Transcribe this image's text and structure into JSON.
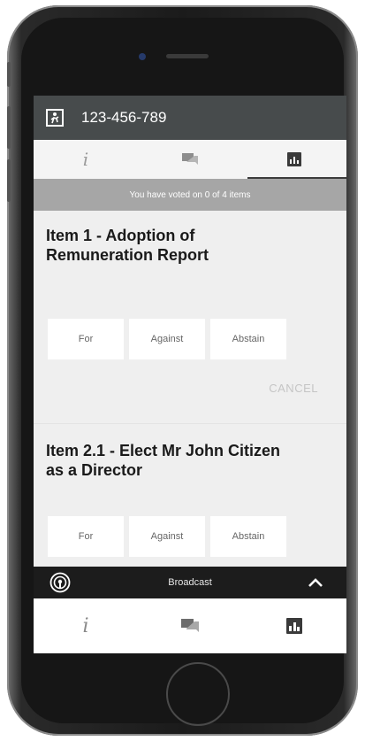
{
  "header": {
    "phone_number": "123-456-789"
  },
  "tabs": [
    {
      "icon": "info-icon",
      "glyph": "i"
    },
    {
      "icon": "chat-icon"
    },
    {
      "icon": "vote-icon",
      "active": true
    }
  ],
  "status": {
    "text": "You have voted on 0 of 4 items"
  },
  "items": [
    {
      "title_line1": "Item 1 - Adoption of",
      "title_line2": "Remuneration Report",
      "options": [
        "For",
        "Against",
        "Abstain"
      ],
      "cancel_label": "CANCEL"
    },
    {
      "title_line1": "Item 2.1 - Elect Mr John Citizen",
      "title_line2": "as a Director",
      "options": [
        "For",
        "Against",
        "Abstain"
      ]
    }
  ],
  "broadcast": {
    "label": "Broadcast",
    "icon": "broadcast-icon",
    "toggle_icon": "chevron-up-icon"
  },
  "bottom_nav": [
    {
      "icon": "info-icon",
      "glyph": "i"
    },
    {
      "icon": "chat-icon"
    },
    {
      "icon": "vote-icon"
    }
  ],
  "colors": {
    "header": "#474b4c",
    "status": "#a6a6a6",
    "background": "#efefef",
    "broadcast": "#1c1c1c"
  }
}
